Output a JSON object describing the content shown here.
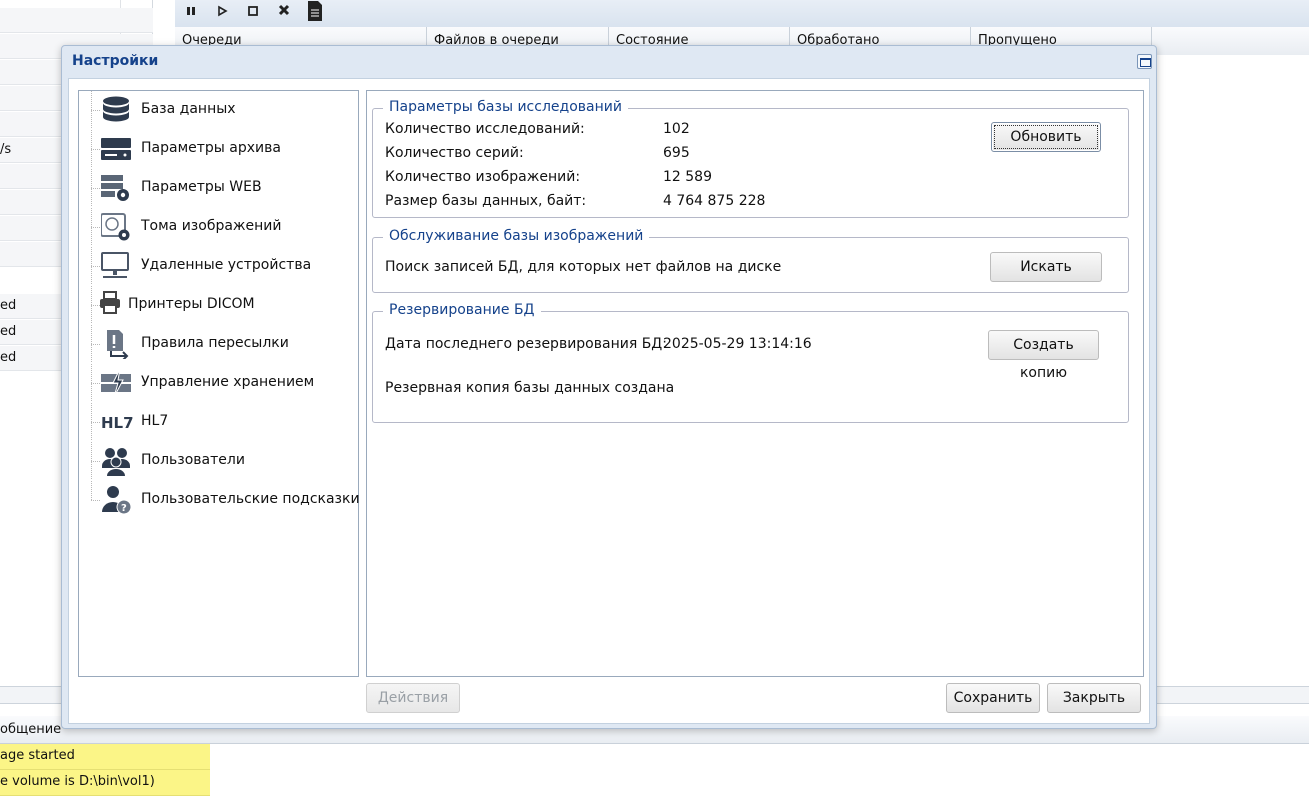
{
  "background": {
    "left_rows": [
      "",
      "",
      "",
      "",
      "",
      "/s",
      "",
      "",
      "",
      "",
      "ed",
      "ed",
      "ed"
    ],
    "columns": [
      "Очереди",
      "Файлов в очереди",
      "Состояние",
      "Обработано",
      "Пропущено"
    ],
    "log_header": "общение",
    "log_rows": [
      "age started",
      "e volume is D:\\bin\\vol1)"
    ]
  },
  "dialog": {
    "title": "Настройки",
    "nav": [
      {
        "label": "База данных",
        "icon": "database-icon"
      },
      {
        "label": "Параметры архива",
        "icon": "server-icon"
      },
      {
        "label": "Параметры WEB",
        "icon": "web-settings-icon"
      },
      {
        "label": "Тома изображений",
        "icon": "volume-settings-icon"
      },
      {
        "label": "Удаленные устройства",
        "icon": "monitor-network-icon"
      },
      {
        "label": "Принтеры DICOM",
        "icon": "printer-icon"
      },
      {
        "label": "Правила пересылки",
        "icon": "forward-rule-icon"
      },
      {
        "label": "Управление хранением",
        "icon": "storage-management-icon"
      },
      {
        "label": "HL7",
        "icon": "hl7-icon"
      },
      {
        "label": "Пользователи",
        "icon": "users-icon"
      },
      {
        "label": "Пользовательские подсказки",
        "icon": "user-help-icon"
      }
    ],
    "db_params": {
      "legend": "Параметры базы исследований",
      "rows": [
        {
          "label": "Количество исследований:",
          "value": "102"
        },
        {
          "label": "Количество серий:",
          "value": "695"
        },
        {
          "label": "Количество изображений:",
          "value": "12 589"
        },
        {
          "label": "Размер базы данных, байт:",
          "value": "4 764 875 228"
        }
      ],
      "refresh_label": "Обновить"
    },
    "maintenance": {
      "legend": "Обслуживание базы изображений",
      "text": "Поиск записей БД, для которых нет файлов на диске",
      "search_label": "Искать"
    },
    "backup": {
      "legend": "Резервирование БД",
      "last_label": "Дата последнего резервирования БД:",
      "last_value": "2025-05-29 13:14:16",
      "status": "Резервная копия базы данных создана",
      "copy_label": "Создать копию"
    },
    "footer": {
      "actions_label": "Действия",
      "save_label": "Сохранить",
      "close_label": "Закрыть"
    }
  }
}
